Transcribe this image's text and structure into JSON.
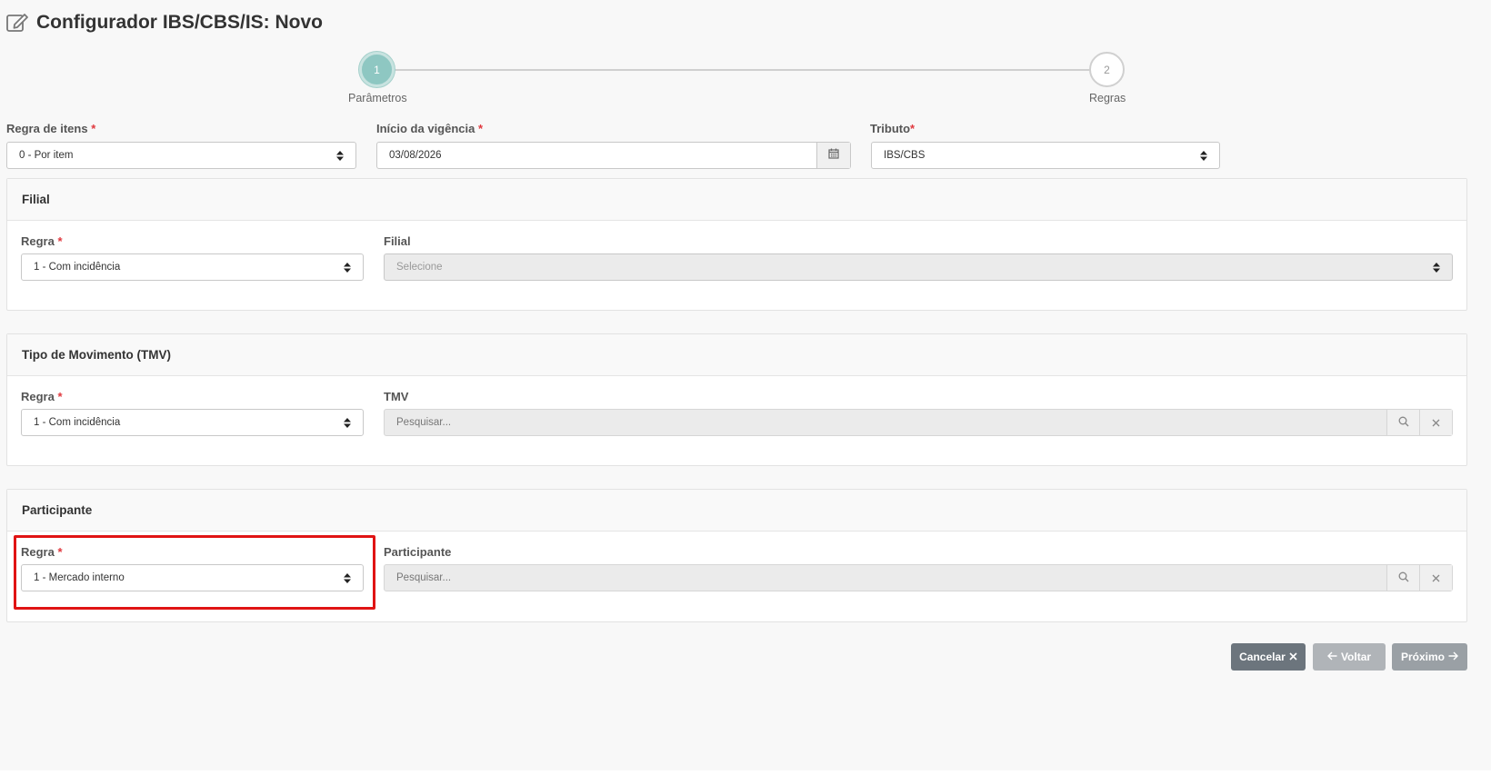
{
  "page": {
    "title": "Configurador IBS/CBS/IS: Novo"
  },
  "stepper": {
    "steps": [
      {
        "number": "1",
        "label": "Parâmetros"
      },
      {
        "number": "2",
        "label": "Regras"
      }
    ]
  },
  "form": {
    "regra_itens": {
      "label": "Regra de itens",
      "required": "*",
      "value": "0 - Por item"
    },
    "inicio_vigencia": {
      "label": "Início da vigência",
      "required": "*",
      "value": "03/08/2026"
    },
    "tributo": {
      "label": "Tributo",
      "required": "*",
      "value": "IBS/CBS"
    }
  },
  "filial": {
    "title": "Filial",
    "regra": {
      "label": "Regra",
      "required": "*",
      "value": "1 - Com incidência"
    },
    "filial": {
      "label": "Filial",
      "placeholder": "Selecione"
    }
  },
  "tmv": {
    "title": "Tipo de Movimento (TMV)",
    "regra": {
      "label": "Regra",
      "required": "*",
      "value": "1 - Com incidência"
    },
    "tmv": {
      "label": "TMV",
      "placeholder": "Pesquisar..."
    }
  },
  "participante": {
    "title": "Participante",
    "regra": {
      "label": "Regra",
      "required": "*",
      "value": "1 - Mercado interno"
    },
    "participante": {
      "label": "Participante",
      "placeholder": "Pesquisar..."
    }
  },
  "actions": {
    "cancel": "Cancelar",
    "back": "Voltar",
    "next": "Próximo"
  },
  "colors": {
    "highlight": "#e01414",
    "step_active": "#8ec7c2",
    "required": "#e0383e"
  }
}
